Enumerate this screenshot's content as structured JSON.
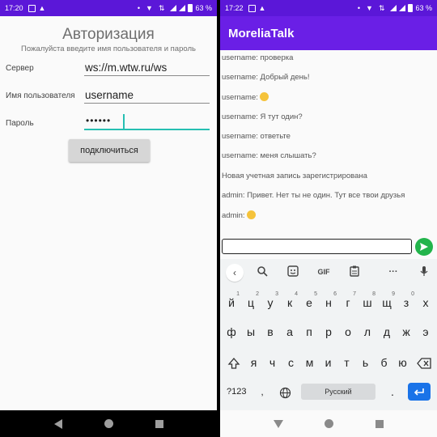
{
  "left": {
    "status": {
      "time": "17:20",
      "battery": "63 %"
    },
    "title": "Авторизация",
    "subtitle": "Пожалуйста введите имя пользователя и пароль",
    "fields": [
      {
        "label": "Сервер",
        "value": "ws://m.wtw.ru/ws"
      },
      {
        "label": "Имя пользователя",
        "value": "username"
      },
      {
        "label": "Пароль",
        "value": "••••••"
      }
    ],
    "connect_label": "подключиться"
  },
  "right": {
    "status": {
      "time": "17:22",
      "battery": "63 %"
    },
    "app_title": "MoreliaTalk",
    "messages": [
      {
        "text": "username: проверка",
        "emoji": false
      },
      {
        "text": "username: Добрый день!",
        "emoji": false
      },
      {
        "text": "username:",
        "emoji": true
      },
      {
        "text": "username: Я тут один?",
        "emoji": false
      },
      {
        "text": "username: ответьте",
        "emoji": false
      },
      {
        "text": "username: меня слышать?",
        "emoji": false
      },
      {
        "text": "Новая учетная запись зарегистрирована",
        "emoji": false
      },
      {
        "text": "admin: Привет. Нет ты не один. Тут все твои друзья",
        "emoji": false
      },
      {
        "text": "admin:",
        "emoji": true
      }
    ],
    "keyboard": {
      "toolbar": [
        "‹",
        "search-icon",
        "sticker-icon",
        "GIF",
        "clipboard-icon",
        "···",
        "mic-icon"
      ],
      "gif_label": "GIF",
      "row1": [
        "й",
        "ц",
        "у",
        "к",
        "е",
        "н",
        "г",
        "ш",
        "щ",
        "з",
        "х"
      ],
      "row1_hints": [
        "1",
        "2",
        "3",
        "4",
        "5",
        "6",
        "7",
        "8",
        "9",
        "0",
        ""
      ],
      "row2": [
        "ф",
        "ы",
        "в",
        "а",
        "п",
        "р",
        "о",
        "л",
        "д",
        "ж",
        "э"
      ],
      "row3": [
        "я",
        "ч",
        "с",
        "м",
        "и",
        "т",
        "ь",
        "б",
        "ю"
      ],
      "sym_label": "?123",
      "comma": ",",
      "space_label": "Русский",
      "period": "."
    }
  },
  "colors": {
    "accent": "#6a1fe6",
    "status": "#5b17d8",
    "focus": "#26bfb2",
    "send": "#22b44b",
    "enter": "#1a73e8"
  }
}
